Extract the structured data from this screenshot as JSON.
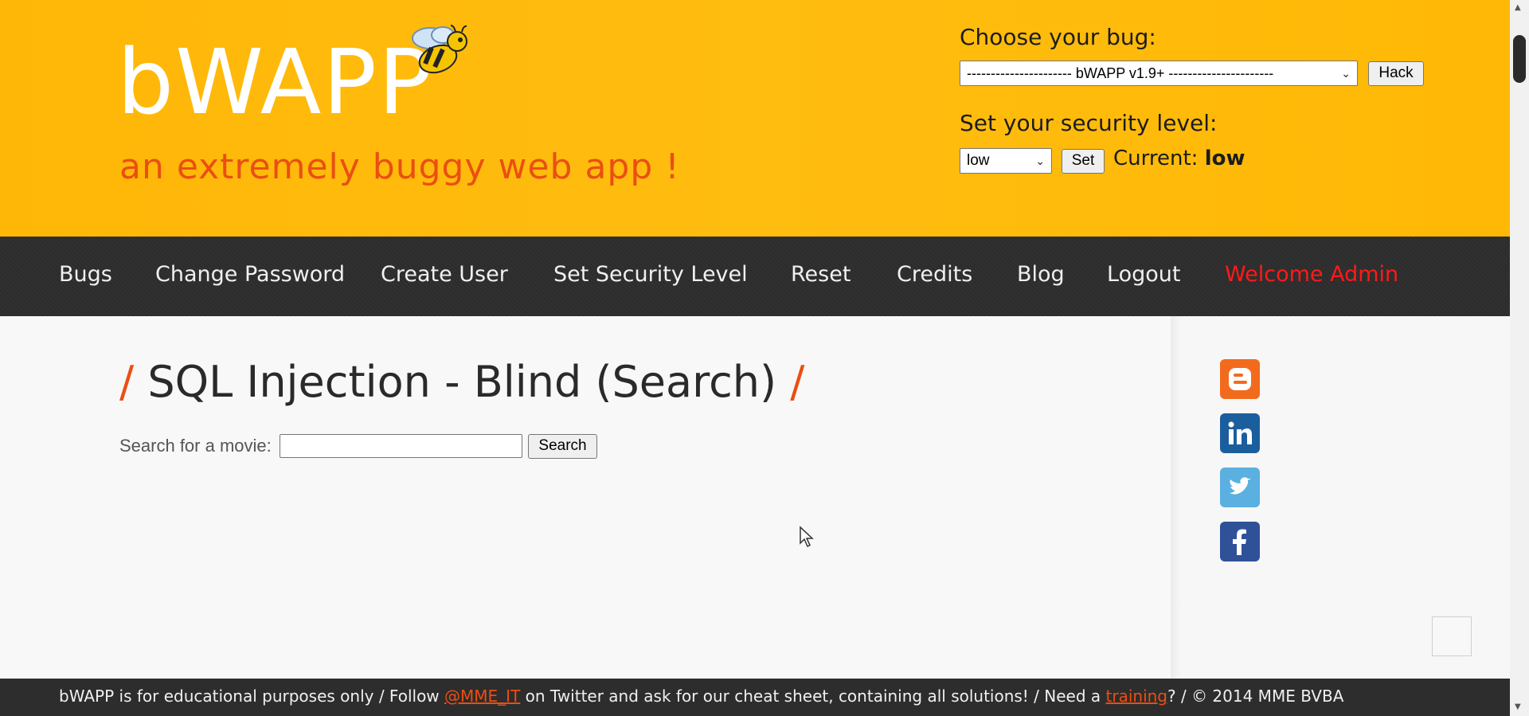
{
  "header": {
    "logo": "bWAPP",
    "tagline": "an extremely buggy web app !",
    "choose_bug_label": "Choose your bug:",
    "bug_selected": "---------------------- bWAPP v1.9+ ----------------------",
    "hack_button": "Hack",
    "security_label": "Set your security level:",
    "security_selected": "low",
    "set_button": "Set",
    "current_label": "Current:",
    "current_value": "low"
  },
  "nav": {
    "items": [
      "Bugs",
      "Change Password",
      "Create User",
      "Set Security Level",
      "Reset",
      "Credits",
      "Blog",
      "Logout"
    ],
    "welcome": "Welcome Admin"
  },
  "main": {
    "title": "SQL Injection - Blind (Search)",
    "slash": "/",
    "search_label": "Search for a movie:",
    "search_value": "",
    "search_button": "Search"
  },
  "sidebar": {
    "icons": [
      "blogger-icon",
      "linkedin-icon",
      "twitter-icon",
      "facebook-icon"
    ]
  },
  "footer": {
    "part1": "bWAPP is for educational purposes only / Follow ",
    "twitter_link": "@MME_IT",
    "part2": " on Twitter and ask for our cheat sheet, containing all solutions! / Need a ",
    "training_link": "training",
    "part3": "? / © 2014 MME BVBA"
  },
  "colors": {
    "header_bg": "#ffb707",
    "accent": "#ea4f12",
    "nav_bg": "#2d2d2d",
    "welcome": "#ff1a1a"
  }
}
